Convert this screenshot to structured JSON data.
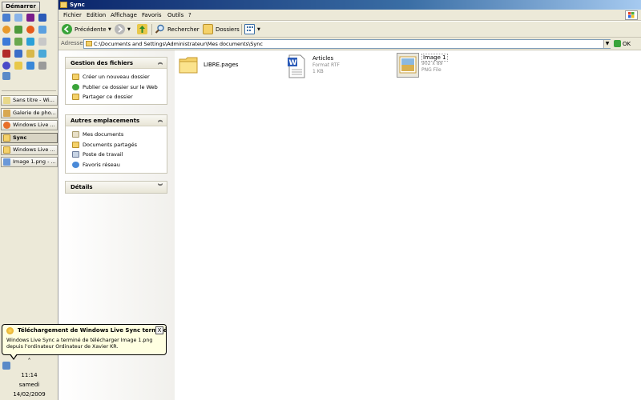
{
  "taskbar": {
    "start_label": "Démarrer",
    "tasks": [
      {
        "label": "Sans titre - Wi..."
      },
      {
        "label": "Galerie de pho..."
      },
      {
        "label": "Windows Live ..."
      },
      {
        "label": "Sync"
      },
      {
        "label": "Windows Live ..."
      },
      {
        "label": "Image 1.png - ..."
      }
    ],
    "clock_time": "11:14",
    "clock_day": "samedi",
    "clock_date": "14/02/2009"
  },
  "window": {
    "title": "Sync",
    "menu": [
      "Fichier",
      "Edition",
      "Affichage",
      "Favoris",
      "Outils",
      "?"
    ],
    "toolbar": {
      "back_label": "Précédente",
      "search_label": "Rechercher",
      "folders_label": "Dossiers"
    },
    "address": {
      "label": "Adresse",
      "value": "C:\\Documents and Settings\\Administrateur\\Mes documents\\Sync",
      "go_label": "OK"
    }
  },
  "taskpane": {
    "file_tasks": {
      "title": "Gestion des fichiers",
      "links": [
        "Créer un nouveau dossier",
        "Publier ce dossier sur le Web",
        "Partager ce dossier"
      ]
    },
    "other_places": {
      "title": "Autres emplacements",
      "links": [
        "Mes documents",
        "Documents partagés",
        "Poste de travail",
        "Favoris réseau"
      ]
    },
    "details": {
      "title": "Détails"
    }
  },
  "files": [
    {
      "name": "LIBRE.pages",
      "type": "",
      "size": ""
    },
    {
      "name": "Articles",
      "type": "Format RTF",
      "size": "1 KB"
    },
    {
      "name": "Image 1",
      "type": "902 x 89",
      "size": "PNG File"
    }
  ],
  "balloon": {
    "title": "Téléchargement de Windows Live Sync terminé",
    "close": "X",
    "message": "Windows Live Sync a terminé de télécharger Image 1.png depuis l'ordinateur Ordinateur de Xavier  KR."
  },
  "colors": {
    "title_bar": "#0a246a",
    "chrome": "#ece9d8",
    "balloon_bg": "#ffffe1"
  },
  "icons": [
    "folder-icon",
    "word-document-icon",
    "image-thumbnail-icon",
    "back-arrow-icon",
    "forward-arrow-icon",
    "up-folder-icon",
    "search-icon",
    "folders-icon",
    "views-icon",
    "go-icon",
    "windows-logo-icon",
    "tray-sync-icon"
  ]
}
